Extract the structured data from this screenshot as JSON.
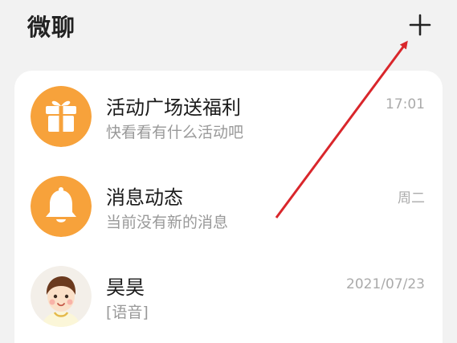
{
  "header": {
    "title": "微聊",
    "add_icon": "plus-icon"
  },
  "colors": {
    "background": "#f2f2f2",
    "card": "#ffffff",
    "icon_orange": "#f7a23b",
    "annotation_arrow": "#d9262b"
  },
  "conversations": [
    {
      "title": "活动广场送福利",
      "subtitle": "快看看有什么活动吧",
      "time": "17:01",
      "avatar_icon": "gift-icon"
    },
    {
      "title": "消息动态",
      "subtitle": "当前没有新的消息",
      "time": "周二",
      "avatar_icon": "bell-icon"
    },
    {
      "title": "昊昊",
      "subtitle": "[语音]",
      "time": "2021/07/23",
      "avatar_icon": "user-avatar"
    }
  ]
}
